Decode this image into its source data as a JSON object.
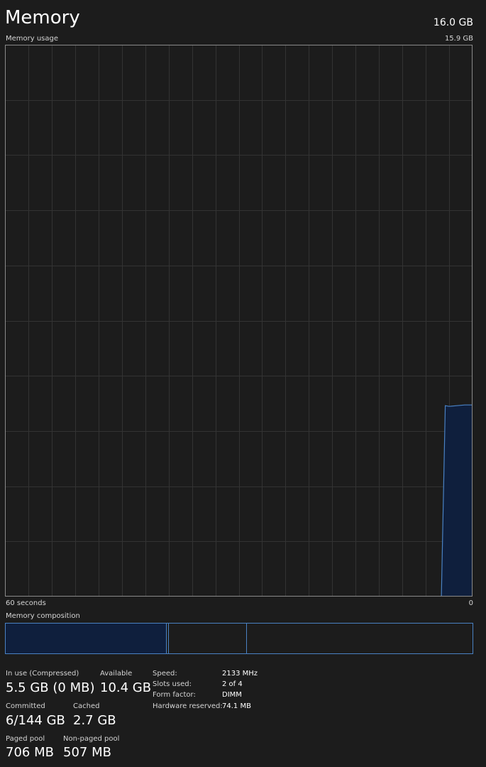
{
  "header": {
    "title": "Memory",
    "total": "16.0 GB"
  },
  "graph": {
    "label": "Memory usage",
    "max_label": "15.9 GB",
    "time_left": "60 seconds",
    "time_right": "0",
    "line_color": "#4a82c4",
    "fill_color": "#0f1f3d",
    "grid_color": "#333333"
  },
  "chart_data": {
    "type": "area",
    "title": "Memory usage",
    "x": [
      60,
      4,
      3.5,
      3,
      2,
      1,
      0
    ],
    "y": [
      0,
      0,
      5.5,
      5.48,
      5.5,
      5.52,
      5.52
    ],
    "xlabel": "60 seconds",
    "xlim": [
      60,
      0
    ],
    "ylim": [
      0,
      15.9
    ],
    "grid": true
  },
  "composition": {
    "label": "Memory composition"
  },
  "stats": {
    "in_use_label": "In use (Compressed)",
    "in_use_value": "5.5 GB (0 MB)",
    "available_label": "Available",
    "available_value": "10.4 GB",
    "committed_label": "Committed",
    "committed_value": "6/144 GB",
    "cached_label": "Cached",
    "cached_value": "2.7 GB",
    "paged_pool_label": "Paged pool",
    "paged_pool_value": "706 MB",
    "non_paged_pool_label": "Non-paged pool",
    "non_paged_pool_value": "507 MB"
  },
  "details": {
    "speed_label": "Speed:",
    "speed_value": "2133 MHz",
    "slots_label": "Slots used:",
    "slots_value": "2 of 4",
    "form_label": "Form factor:",
    "form_value": "DIMM",
    "reserved_label": "Hardware reserved:",
    "reserved_value": "74.1 MB"
  }
}
